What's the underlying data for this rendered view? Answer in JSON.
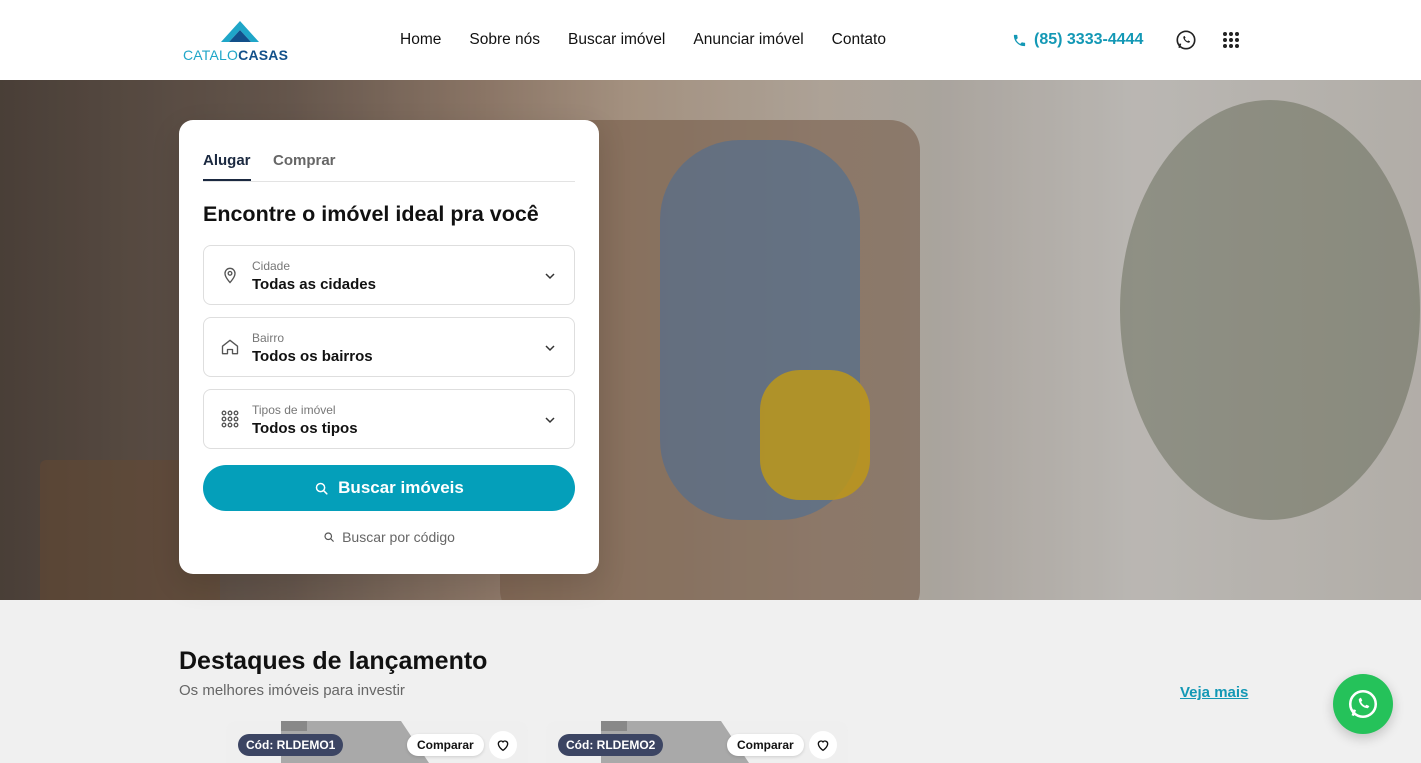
{
  "brand": {
    "logo_part1": "CATALO",
    "logo_part2": "CASAS",
    "accent": "#049fba",
    "dark": "#1b2940"
  },
  "nav": {
    "items": [
      "Home",
      "Sobre nós",
      "Buscar imóvel",
      "Anunciar imóvel",
      "Contato"
    ]
  },
  "header": {
    "phone": "(85) 3333-4444",
    "icons": [
      "phone-icon",
      "whatsapp-icon",
      "grid-menu-icon"
    ]
  },
  "search": {
    "tabs": [
      "Alugar",
      "Comprar"
    ],
    "active_tab": "Alugar",
    "title": "Encontre o imóvel ideal pra você",
    "fields": [
      {
        "label": "Cidade",
        "value": "Todas as cidades",
        "icon": "location-pin-icon"
      },
      {
        "label": "Bairro",
        "value": "Todos os bairros",
        "icon": "house-icon"
      },
      {
        "label": "Tipos de imóvel",
        "value": "Todos os tipos",
        "icon": "grid-icon"
      }
    ],
    "button": "Buscar imóveis",
    "by_code": "Buscar por código"
  },
  "section": {
    "title": "Destaques de lançamento",
    "subtitle": "Os melhores imóveis para investir",
    "see_more": "Veja mais"
  },
  "listings": [
    {
      "code": "Cód: RLDEMO1",
      "compare": "Comparar"
    },
    {
      "code": "Cód: RLDEMO2",
      "compare": "Comparar"
    }
  ]
}
